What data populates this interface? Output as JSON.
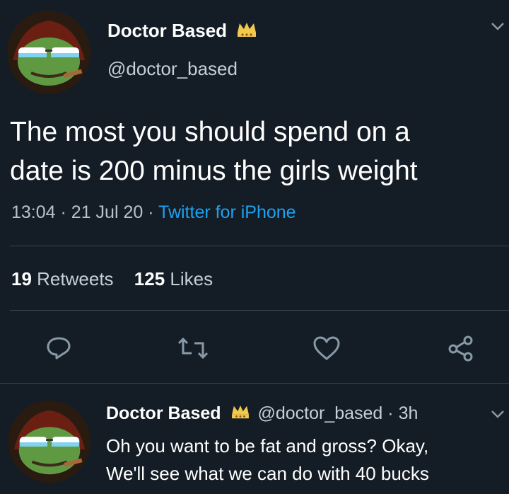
{
  "tweet": {
    "display_name": "Doctor Based",
    "handle": "@doctor_based",
    "text_line1": "The most you should spend on a",
    "text_line2": "date is 200 minus the girls weight",
    "time": "13:04",
    "date": "21 Jul 20",
    "source": "Twitter for iPhone",
    "retweets_count": "19",
    "retweets_label": "Retweets",
    "likes_count": "125",
    "likes_label": "Likes",
    "badge_icon": "crown-icon"
  },
  "reply": {
    "display_name": "Doctor Based",
    "handle": "@doctor_based",
    "age": "3h",
    "text_line1": "Oh you want to be fat and gross? Okay,",
    "text_line2": "We'll see what we can do with 40 bucks"
  },
  "actions": [
    "reply-icon",
    "retweet-icon",
    "like-icon",
    "share-icon"
  ],
  "colors": {
    "background": "#141d26",
    "text": "#ffffff",
    "muted": "#8899a6",
    "link": "#1da1f2",
    "divider": "#38444d",
    "crown": "#f2c94c"
  }
}
